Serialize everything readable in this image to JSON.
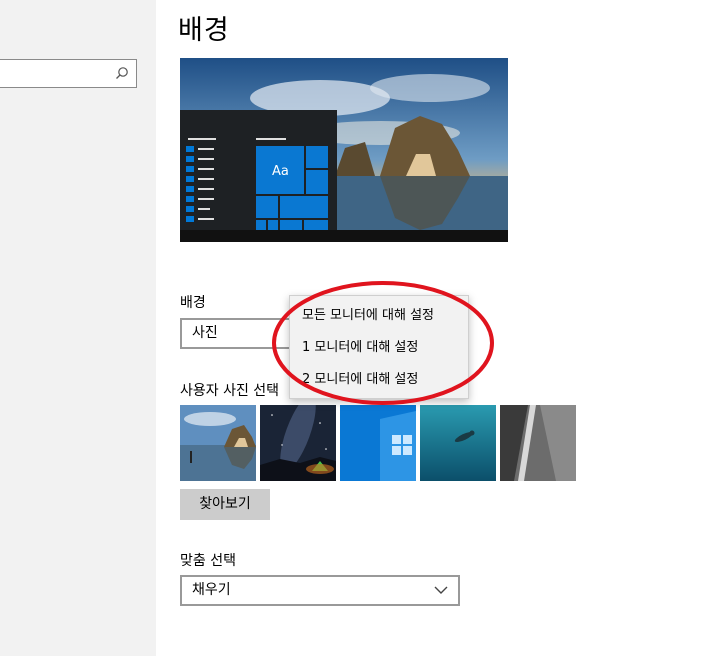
{
  "sidebar": {
    "search": {
      "value": "",
      "icon": "search-icon"
    }
  },
  "page": {
    "title": "배경"
  },
  "preview": {
    "tile_label": "Aa"
  },
  "background": {
    "label": "배경",
    "value": "사진"
  },
  "context_menu": {
    "items": [
      {
        "label": "모든 모니터에 대해 설정"
      },
      {
        "label": "1 모니터에 대해 설정"
      },
      {
        "label": "2 모니터에 대해 설정"
      }
    ]
  },
  "photos": {
    "label": "사용자 사진 선택",
    "thumbnails": [
      "beach-arch",
      "milky-way-camp",
      "windows-logo",
      "underwater-swimmer",
      "rock-waterfall"
    ],
    "browse_label": "찾아보기"
  },
  "fit": {
    "label": "맞춤 선택",
    "value": "채우기"
  },
  "colors": {
    "accent": "#0078d7",
    "annotation": "#e0141e"
  }
}
